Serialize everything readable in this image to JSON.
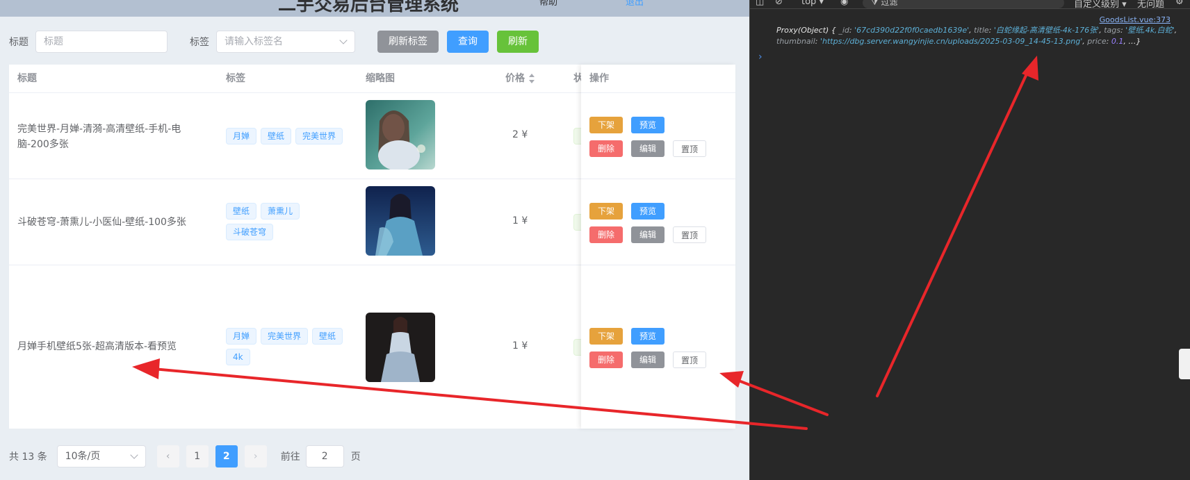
{
  "app": {
    "header": {
      "title": "二手交易后台管理系统",
      "right_a": "帮助",
      "right_b": "退出"
    },
    "filters": {
      "title_label": "标题",
      "title_placeholder": "标题",
      "tag_label": "标签",
      "tag_placeholder": "请输入标签名",
      "refresh_tags_label": "刷新标签",
      "query_label": "查询",
      "refresh_label": "刷新"
    },
    "table": {
      "columns": {
        "title": "标题",
        "tags": "标签",
        "thumbnail": "缩略图",
        "price": "价格",
        "status": "状",
        "actions": "操作"
      },
      "rows": [
        {
          "title": "完美世界-月婵-清漪-高清壁纸-手机-电脑-200多张",
          "tags": [
            "月婵",
            "壁纸",
            "完美世界"
          ],
          "price": "2 ¥"
        },
        {
          "title": "斗破苍穹-萧熏儿-小医仙-壁纸-100多张",
          "tags": [
            "壁纸",
            "萧熏儿",
            "斗破苍穹"
          ],
          "price": "1 ¥"
        },
        {
          "title": "月婵手机壁纸5张-超高清版本-看预览",
          "tags": [
            "月婵",
            "完美世界",
            "壁纸",
            "4k"
          ],
          "price": "1 ¥"
        }
      ],
      "actions": {
        "offline": "下架",
        "preview": "预览",
        "delete": "删除",
        "edit": "编辑",
        "pin": "置顶"
      }
    },
    "pagination": {
      "total": "共 13 条",
      "page_size": "10条/页",
      "pages": [
        "1",
        "2"
      ],
      "current_page": "2",
      "goto_label": "前往",
      "goto_value": "2",
      "page_suffix": "页"
    },
    "colors": {
      "primary": "#409eff",
      "success": "#67c23a",
      "warning": "#e6a23c",
      "danger": "#f56c6c",
      "info": "#909399",
      "annotation": "#e8262a"
    }
  },
  "devtools": {
    "context": "top",
    "filter_placeholder": "过滤",
    "level": "自定义级别",
    "issues": "无问题",
    "source_link": "GoodsList.vue:373",
    "log": {
      "prefix": "Proxy(Object) {",
      "id_key": "_id",
      "id_value": "'67cd390d22f0f0caedb1639e'",
      "title_key": "title",
      "title_value": "'白蛇缘起-高清壁纸-4k-176张'",
      "tags_key": "tags",
      "tags_value": "'壁纸,4k,白蛇'",
      "thumb_key": "thumbnail",
      "thumb_value": "'https://dbg.server.wangyinjie.cn/uploads/2025-03-09_14-45-13.png'",
      "price_key": "price",
      "price_value": "0.1",
      "suffix": ", …}"
    }
  }
}
